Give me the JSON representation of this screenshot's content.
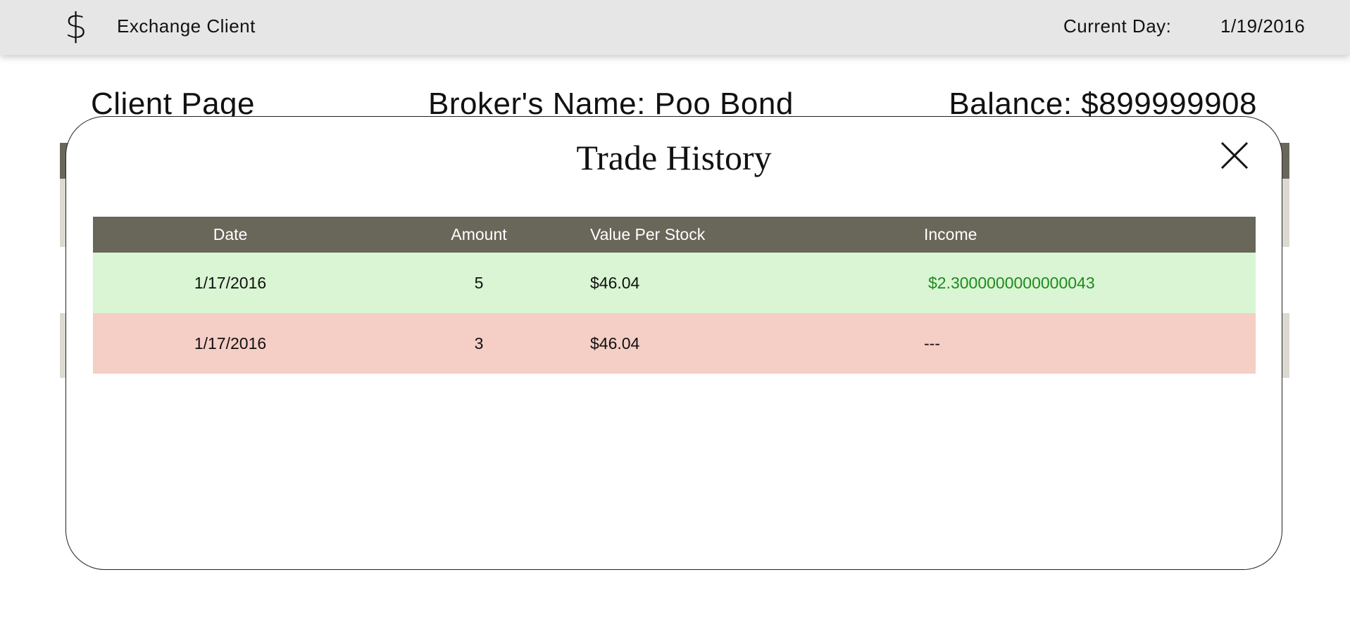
{
  "navbar": {
    "logo_symbol": "$",
    "app_title": "Exchange Client",
    "current_day_label": "Current Day:",
    "current_day_value": "1/19/2016"
  },
  "page_header": {
    "title": "Client Page",
    "broker": "Broker's Name: Poo Bond",
    "balance": "Balance: $899999908"
  },
  "modal": {
    "title": "Trade History",
    "close_icon": "close-icon",
    "columns": [
      "Date",
      "Amount",
      "Value Per Stock",
      "Income"
    ],
    "rows": [
      {
        "date": "1/17/2016",
        "amount": "5",
        "value_per_stock": "$46.04",
        "income": "$2.3000000000000043",
        "type": "buy"
      },
      {
        "date": "1/17/2016",
        "amount": "3",
        "value_per_stock": "$46.04",
        "income": "---",
        "type": "sell"
      }
    ]
  },
  "colors": {
    "navbar_bg": "#e6e6e6",
    "table_header_bg": "#69665a",
    "row_positive_bg": "#d9f5d3",
    "row_negative_bg": "#f5cec6",
    "income_positive_text": "#1f8a1f"
  }
}
